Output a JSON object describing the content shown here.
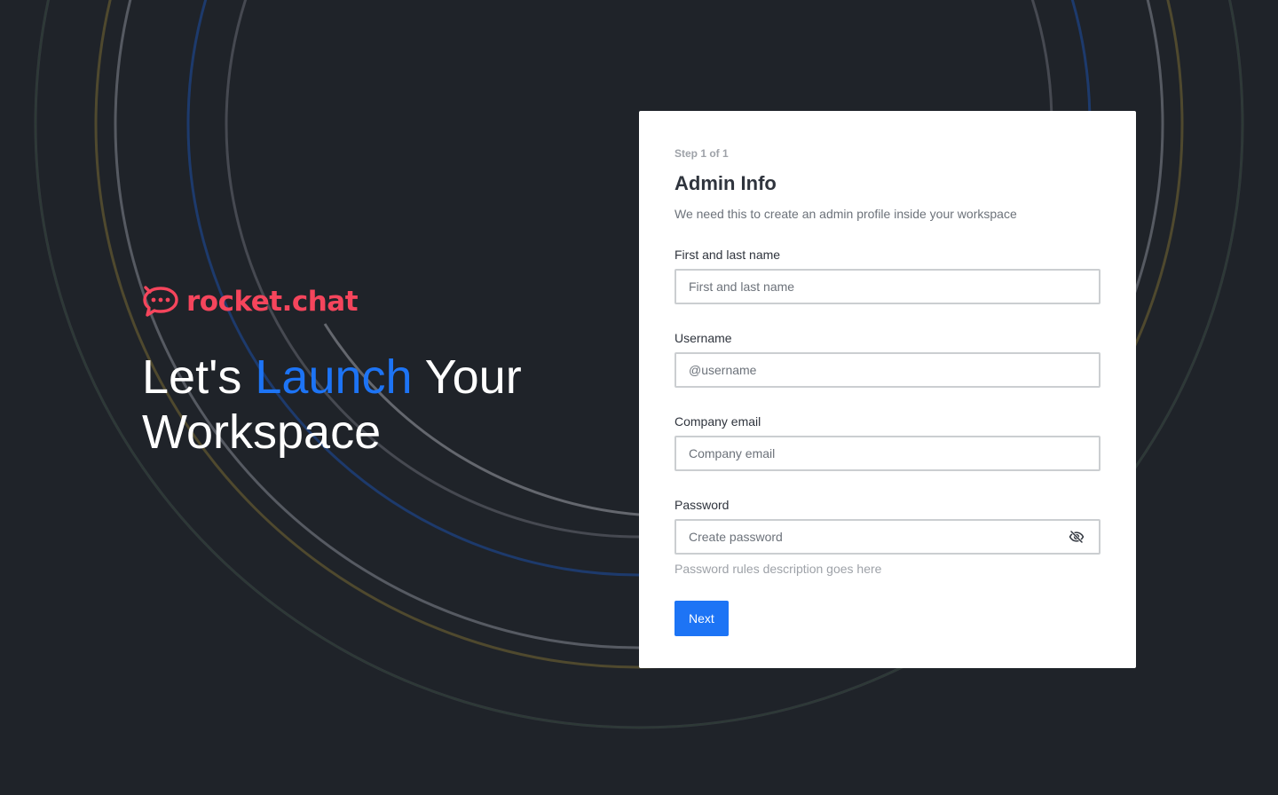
{
  "brand": {
    "name": "rocket.chat",
    "logo_icon": "rocket-chat-bubble-icon",
    "color": "#f5455c"
  },
  "hero": {
    "headline_part1": "Let's ",
    "headline_accent": "Launch",
    "headline_part2": " Your",
    "headline_line2": "Workspace",
    "accent_color": "#1d74f5"
  },
  "form": {
    "step": "Step 1 of 1",
    "title": "Admin Info",
    "subtitle": "We need this to create an admin profile inside your workspace",
    "fields": [
      {
        "label": "First and last name",
        "placeholder": "First and last name",
        "value": ""
      },
      {
        "label": "Username",
        "placeholder": "@username",
        "value": ""
      },
      {
        "label": "Company email",
        "placeholder": "Company email",
        "value": ""
      },
      {
        "label": "Password",
        "placeholder": "Create password",
        "value": "",
        "toggle_icon": "eye-off-icon"
      }
    ],
    "password_hint": "Password rules description goes here",
    "next_label": "Next"
  },
  "colors": {
    "background": "#1f2329",
    "card": "#ffffff",
    "primary": "#1d74f5",
    "brand_red": "#f5455c"
  }
}
